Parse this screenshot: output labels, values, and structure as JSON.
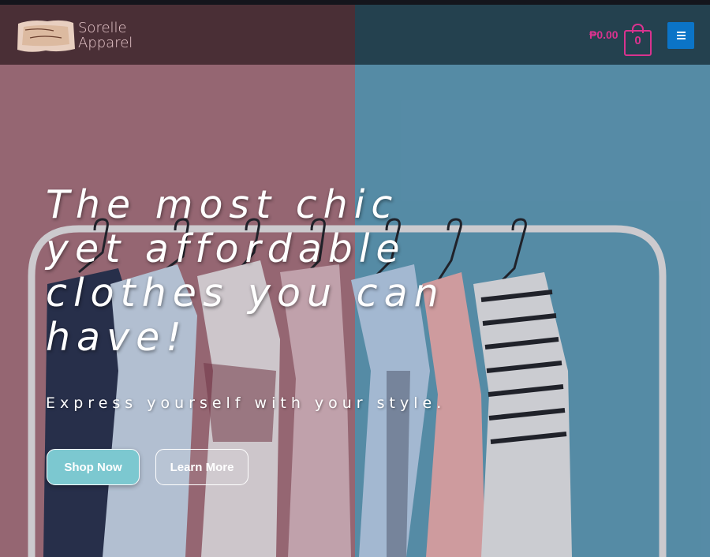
{
  "header": {
    "brand_line1": "Sorelle",
    "brand_line2": "Apparel",
    "logo_text": "Sorelle Apparel",
    "cart_total": "₱0.00",
    "cart_count": "0",
    "menu_icon": "hamburger-icon"
  },
  "hero": {
    "headline_lines": [
      "The most chic",
      "yet affordable",
      "clothes you can",
      "have!"
    ],
    "subheadline": "Express yourself with your style.",
    "buttons": {
      "shop_label": "Shop Now",
      "learn_label": "Learn More"
    }
  },
  "colors": {
    "accent_pink": "#d9338f",
    "menu_blue": "#0b74c7",
    "shop_button": "#7cc8d0",
    "wall_pink": "#a8717e",
    "wall_blue": "#5f9bb8"
  }
}
